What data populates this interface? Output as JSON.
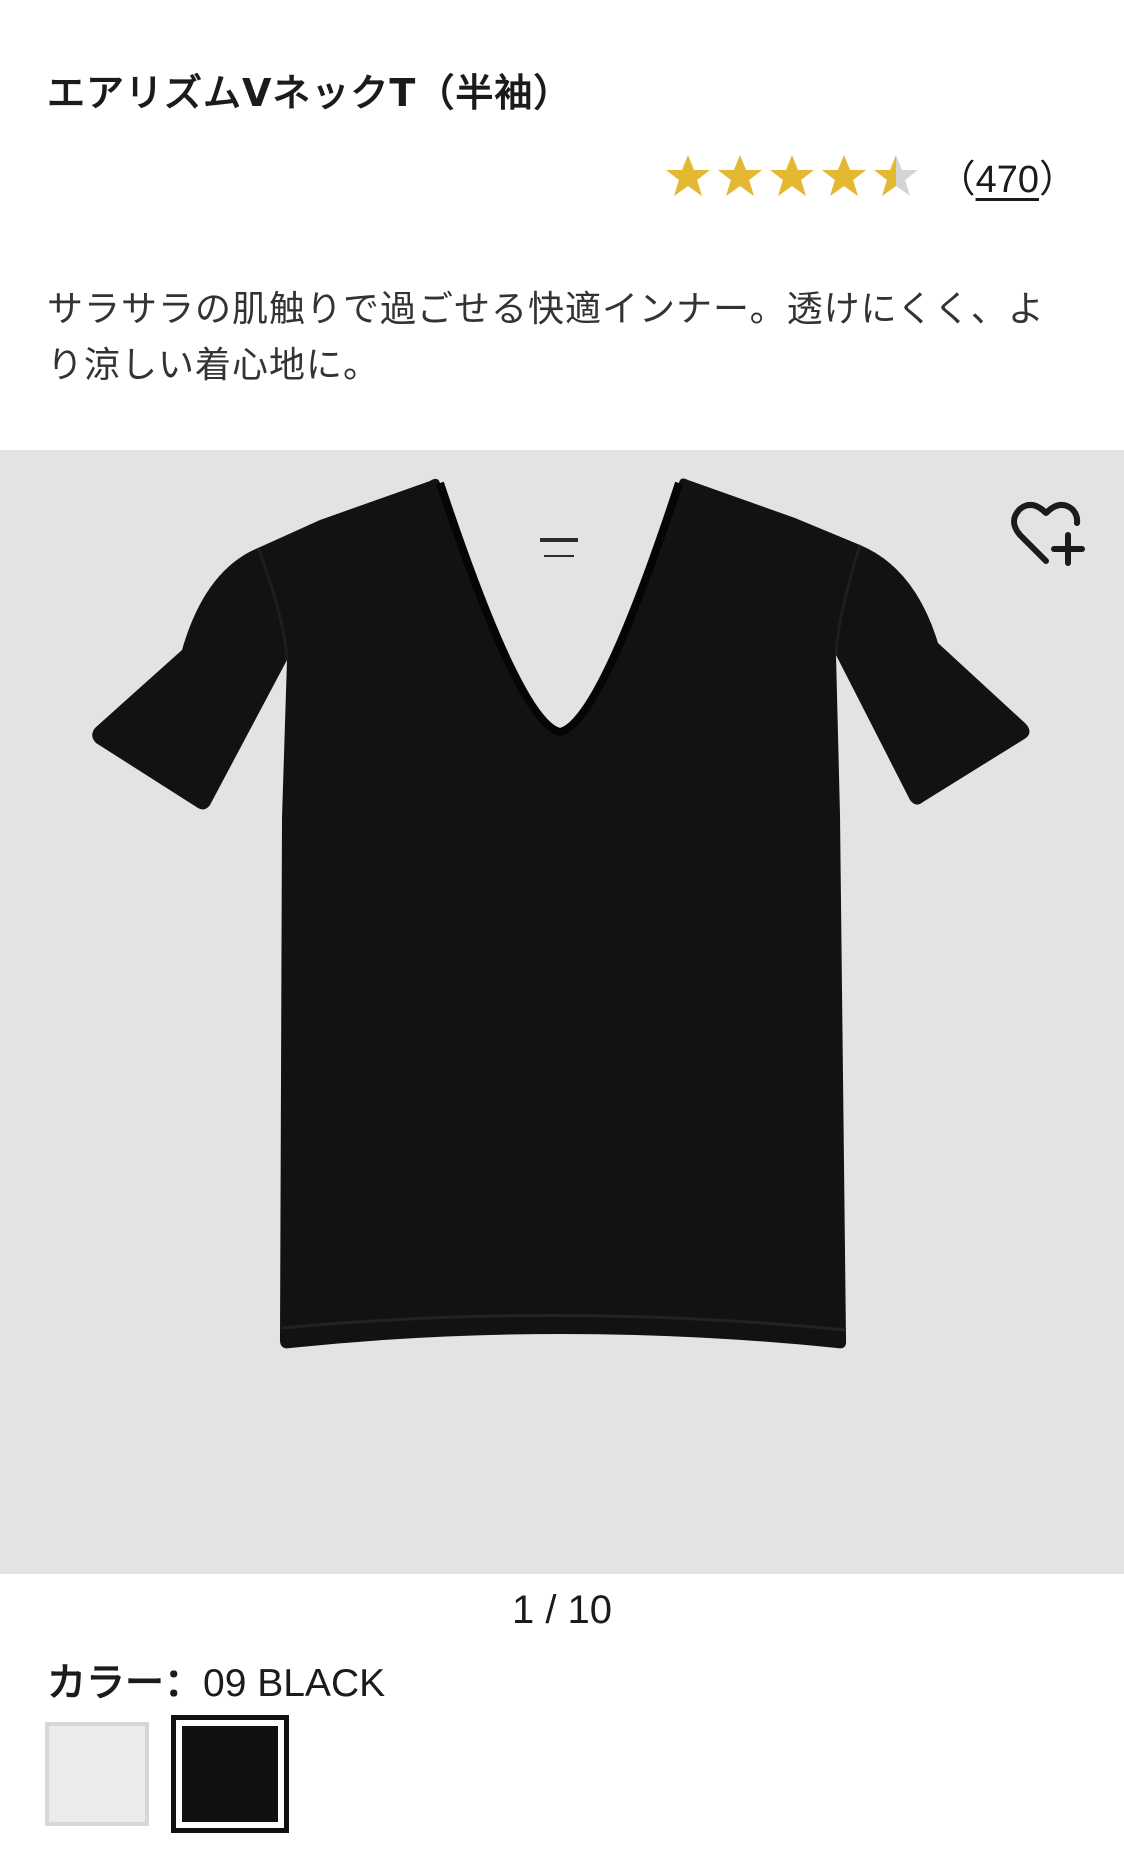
{
  "product": {
    "title": "エアリズムVネックT（半袖）",
    "rating": {
      "value": 4.5,
      "max": 5,
      "count_open": "（",
      "count": "470",
      "count_close": "）"
    },
    "description": "サラサラの肌触りで過ごせる快適インナー。透けにくく、より涼しい着心地に。"
  },
  "gallery": {
    "pager": "1 / 10",
    "favorite_icon": "heart-plus-icon",
    "background": "#e3e3e5"
  },
  "color": {
    "label": "カラー：",
    "value": "09 BLACK",
    "swatches": [
      {
        "name": "white",
        "hex": "#ebebeb"
      },
      {
        "name": "black",
        "hex": "#111111",
        "selected": true
      }
    ]
  },
  "colors": {
    "star": "#e5b832",
    "star_empty": "#d4d4d4"
  }
}
